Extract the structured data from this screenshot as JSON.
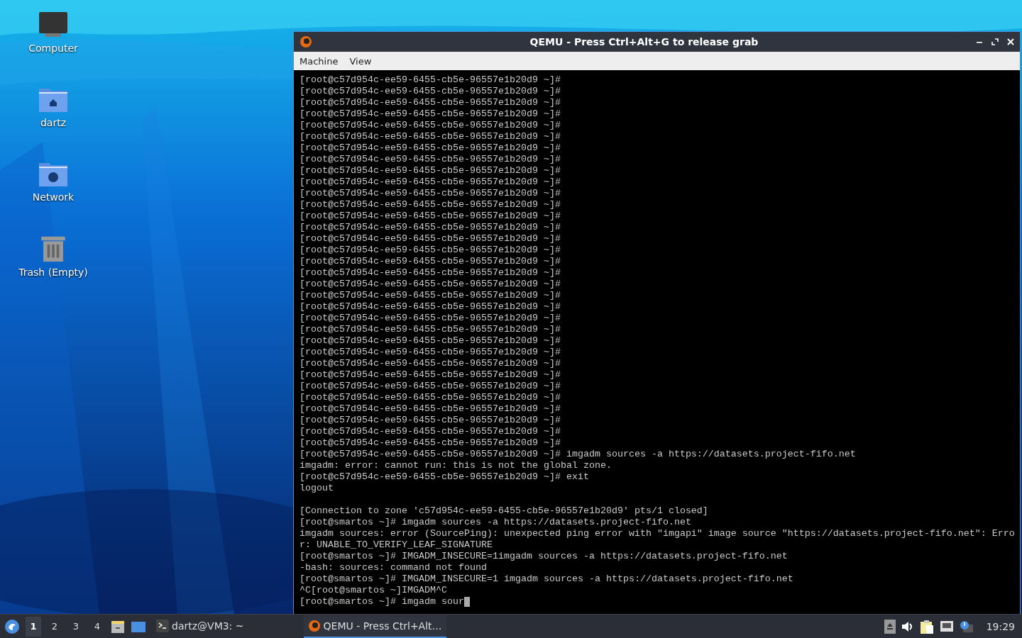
{
  "desktop_icons": [
    {
      "kind": "computer",
      "label": "Computer"
    },
    {
      "kind": "home",
      "label": "dartz"
    },
    {
      "kind": "network",
      "label": "Network"
    },
    {
      "kind": "trash",
      "label": "Trash (Empty)"
    }
  ],
  "window": {
    "title": "QEMU - Press Ctrl+Alt+G to release grab",
    "menu": [
      "Machine",
      "View"
    ],
    "terminal": {
      "cursor": true,
      "blocks": [
        [
          "[root@c57d954c-ee59-6455-cb5e-96557e1b20d9 ~]#",
          "[root@c57d954c-ee59-6455-cb5e-96557e1b20d9 ~]#",
          "[root@c57d954c-ee59-6455-cb5e-96557e1b20d9 ~]#",
          "[root@c57d954c-ee59-6455-cb5e-96557e1b20d9 ~]#",
          "[root@c57d954c-ee59-6455-cb5e-96557e1b20d9 ~]#",
          "[root@c57d954c-ee59-6455-cb5e-96557e1b20d9 ~]#",
          "[root@c57d954c-ee59-6455-cb5e-96557e1b20d9 ~]#",
          "[root@c57d954c-ee59-6455-cb5e-96557e1b20d9 ~]#",
          "[root@c57d954c-ee59-6455-cb5e-96557e1b20d9 ~]#",
          "[root@c57d954c-ee59-6455-cb5e-96557e1b20d9 ~]#",
          "[root@c57d954c-ee59-6455-cb5e-96557e1b20d9 ~]#",
          "[root@c57d954c-ee59-6455-cb5e-96557e1b20d9 ~]#",
          "[root@c57d954c-ee59-6455-cb5e-96557e1b20d9 ~]#",
          "[root@c57d954c-ee59-6455-cb5e-96557e1b20d9 ~]#",
          "[root@c57d954c-ee59-6455-cb5e-96557e1b20d9 ~]#",
          "[root@c57d954c-ee59-6455-cb5e-96557e1b20d9 ~]#",
          "[root@c57d954c-ee59-6455-cb5e-96557e1b20d9 ~]#",
          "[root@c57d954c-ee59-6455-cb5e-96557e1b20d9 ~]#",
          "[root@c57d954c-ee59-6455-cb5e-96557e1b20d9 ~]#",
          "[root@c57d954c-ee59-6455-cb5e-96557e1b20d9 ~]#",
          "[root@c57d954c-ee59-6455-cb5e-96557e1b20d9 ~]#",
          "[root@c57d954c-ee59-6455-cb5e-96557e1b20d9 ~]#",
          "[root@c57d954c-ee59-6455-cb5e-96557e1b20d9 ~]#",
          "[root@c57d954c-ee59-6455-cb5e-96557e1b20d9 ~]#",
          "[root@c57d954c-ee59-6455-cb5e-96557e1b20d9 ~]#",
          "[root@c57d954c-ee59-6455-cb5e-96557e1b20d9 ~]#",
          "[root@c57d954c-ee59-6455-cb5e-96557e1b20d9 ~]#",
          "[root@c57d954c-ee59-6455-cb5e-96557e1b20d9 ~]#",
          "[root@c57d954c-ee59-6455-cb5e-96557e1b20d9 ~]#",
          "[root@c57d954c-ee59-6455-cb5e-96557e1b20d9 ~]#",
          "[root@c57d954c-ee59-6455-cb5e-96557e1b20d9 ~]#",
          "[root@c57d954c-ee59-6455-cb5e-96557e1b20d9 ~]#",
          "[root@c57d954c-ee59-6455-cb5e-96557e1b20d9 ~]#",
          "[root@c57d954c-ee59-6455-cb5e-96557e1b20d9 ~]# imgadm sources -a https://datasets.project-fifo.net",
          "imgadm: error: cannot run: this is not the global zone.",
          "[root@c57d954c-ee59-6455-cb5e-96557e1b20d9 ~]# exit",
          "logout"
        ],
        [
          "[Connection to zone 'c57d954c-ee59-6455-cb5e-96557e1b20d9' pts/1 closed]",
          "[root@smartos ~]# imgadm sources -a https://datasets.project-fifo.net",
          "imgadm sources: error (SourcePing): unexpected ping error with \"imgapi\" image source \"https://datasets.project-fifo.net\": Erro",
          "r: UNABLE_TO_VERIFY_LEAF_SIGNATURE",
          "[root@smartos ~]# IMGADM_INSECURE=1imgadm sources -a https://datasets.project-fifo.net",
          "-bash: sources: command not found",
          "[root@smartos ~]# IMGADM_INSECURE=1 imgadm sources -a https://datasets.project-fifo.net",
          "^C[root@smartos ~]IMGADM^C",
          "[root@smartos ~]# imgadm sour"
        ]
      ]
    }
  },
  "taskbar": {
    "workspaces": [
      {
        "label": "1",
        "selected": true
      },
      {
        "label": "2",
        "selected": false
      },
      {
        "label": "3",
        "selected": false
      },
      {
        "label": "4",
        "selected": false
      }
    ],
    "tasks": [
      {
        "kind": "terminal",
        "label": "dartz@VM3: ~",
        "selected": false
      },
      {
        "kind": "qemu",
        "label": "QEMU - Press Ctrl+Alt…",
        "selected": true
      }
    ],
    "clock": "19:29"
  }
}
